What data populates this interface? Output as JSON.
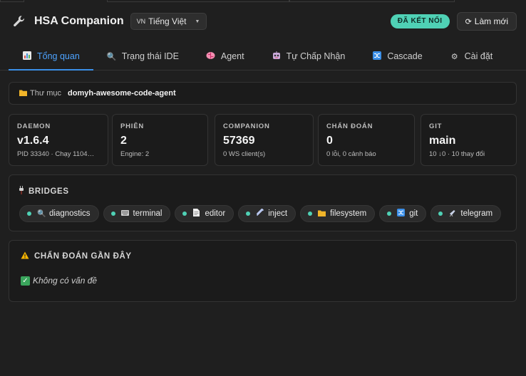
{
  "header": {
    "title": "HSA Companion",
    "language": {
      "code": "VN",
      "label": "Tiếng Việt"
    },
    "status": "ĐÃ KẾT NỐI",
    "refresh_label": "Làm mới"
  },
  "tabs": [
    {
      "label": "Tổng quan",
      "icon": "chart-icon",
      "active": true
    },
    {
      "label": "Trạng thái IDE",
      "icon": "magnifier-icon",
      "active": false
    },
    {
      "label": "Agent",
      "icon": "brain-icon",
      "active": false
    },
    {
      "label": "Tự Chấp Nhận",
      "icon": "robot-icon",
      "active": false
    },
    {
      "label": "Cascade",
      "icon": "shuffle-icon",
      "active": false
    },
    {
      "label": "Cài đặt",
      "icon": "gear-icon",
      "active": false
    }
  ],
  "folder": {
    "label": "Thư mục",
    "value": "domyh-awesome-code-agent"
  },
  "stats": [
    {
      "label": "DAEMON",
      "value": "v1.6.4",
      "sub": "PID 33340 · Chạy 1104…"
    },
    {
      "label": "PHIÊN",
      "value": "2",
      "sub": "Engine: 2"
    },
    {
      "label": "COMPANION",
      "value": "57369",
      "sub": "0 WS client(s)"
    },
    {
      "label": "CHẨN ĐOÁN",
      "value": "0",
      "sub": "0 lỗi, 0 cảnh báo"
    },
    {
      "label": "GIT",
      "value": "main",
      "sub": "10 ↓0 · 10 thay đổi"
    }
  ],
  "bridges": {
    "title": "BRIDGES",
    "items": [
      {
        "label": "diagnostics",
        "icon": "magnifier-icon",
        "status": "connected"
      },
      {
        "label": "terminal",
        "icon": "keyboard-icon",
        "status": "connected"
      },
      {
        "label": "editor",
        "icon": "document-icon",
        "status": "connected"
      },
      {
        "label": "inject",
        "icon": "syringe-icon",
        "status": "connected"
      },
      {
        "label": "filesystem",
        "icon": "folder-icon",
        "status": "connected"
      },
      {
        "label": "git",
        "icon": "shuffle-icon",
        "status": "connected"
      },
      {
        "label": "telegram",
        "icon": "telescope-icon",
        "status": "connected"
      }
    ]
  },
  "diagnostics": {
    "title": "CHẨN ĐOÁN GẦN ĐÂY",
    "empty_text": "Không có vấn đề"
  },
  "colors": {
    "accent": "#3b8fe8",
    "status_ok": "#4fd1b5",
    "background": "#1f1f1f"
  }
}
